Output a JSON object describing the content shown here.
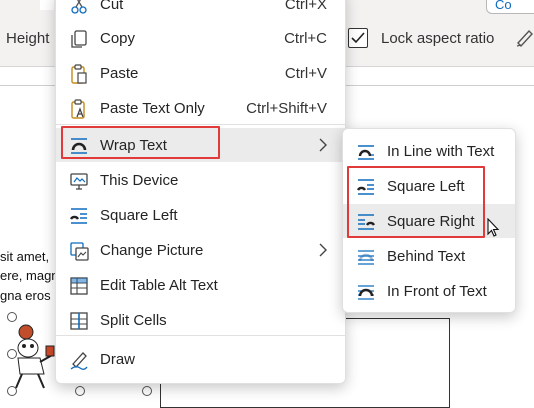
{
  "ribbon": {
    "height_label": "Height",
    "lock_aspect_label": "Lock aspect ratio",
    "lock_aspect_checked": true,
    "comment_button_label": "Co"
  },
  "document": {
    "lines": [
      "sit amet,",
      "ere, magn",
      "gna eros"
    ]
  },
  "context_menu": {
    "items": [
      {
        "label": "Cut",
        "shortcut": "Ctrl+X",
        "icon": "scissors-icon"
      },
      {
        "label": "Copy",
        "shortcut": "Ctrl+C",
        "icon": "copy-icon"
      },
      {
        "label": "Paste",
        "shortcut": "Ctrl+V",
        "icon": "clipboard-icon"
      },
      {
        "label": "Paste Text Only",
        "shortcut": "Ctrl+Shift+V",
        "icon": "paste-text-icon"
      },
      {
        "label": "Wrap Text",
        "icon": "wrap-text-icon",
        "has_submenu": true
      },
      {
        "label": "This Device",
        "icon": "monitor-icon"
      },
      {
        "label": "Square Left",
        "icon": "square-left-wrap-icon"
      },
      {
        "label": "Change Picture",
        "icon": "change-picture-icon",
        "has_submenu": true
      },
      {
        "label": "Edit Table Alt Text",
        "icon": "table-alt-text-icon"
      },
      {
        "label": "Split Cells",
        "icon": "split-cells-icon"
      },
      {
        "label": "Draw",
        "icon": "draw-icon"
      }
    ]
  },
  "wrap_submenu": {
    "items": [
      {
        "label": "In Line with Text",
        "icon": "inline-wrap-icon"
      },
      {
        "label": "Square Left",
        "icon": "square-left-wrap-icon"
      },
      {
        "label": "Square Right",
        "icon": "square-right-wrap-icon"
      },
      {
        "label": "Behind Text",
        "icon": "behind-text-icon"
      },
      {
        "label": "In Front of Text",
        "icon": "in-front-text-icon"
      }
    ]
  },
  "colors": {
    "accent": "#0f6cbd",
    "highlight_box": "#e03a3a",
    "hover_bg": "#ebebeb"
  }
}
